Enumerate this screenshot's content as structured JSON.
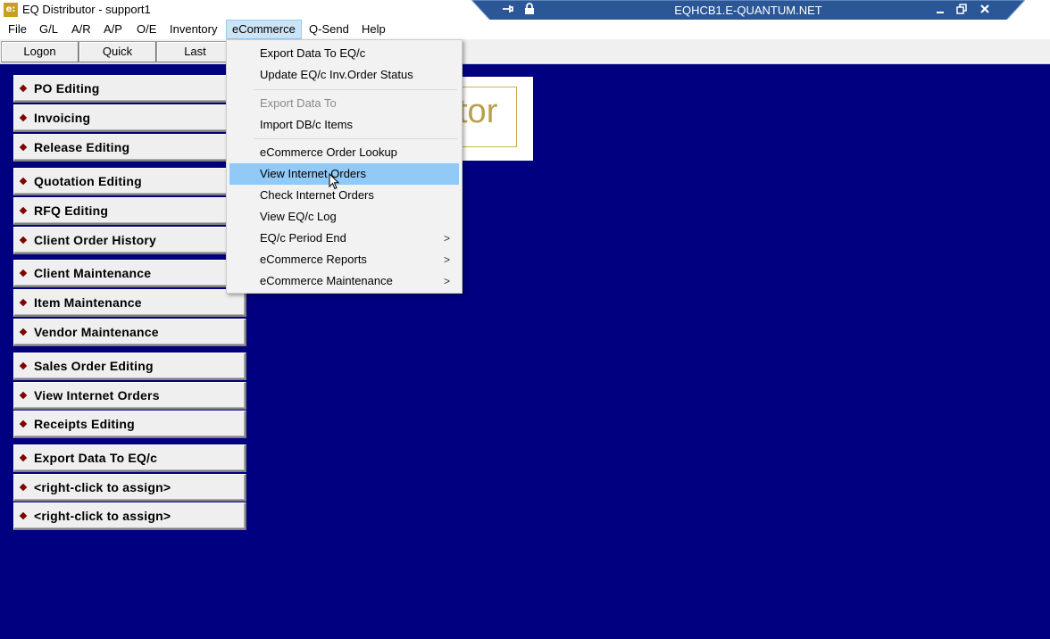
{
  "window": {
    "title": "EQ Distributor - support1",
    "icon_text": "e:"
  },
  "remote": {
    "host": "EQHCB1.E-QUANTUM.NET",
    "pin_icon": "pin-icon",
    "lock_icon": "lock-icon",
    "minimize_icon": "minimize-icon",
    "restore_icon": "restore-icon",
    "close_icon": "close-icon"
  },
  "menubar": {
    "items": [
      "File",
      "G/L",
      "A/R",
      "A/P",
      "O/E",
      "Inventory",
      "eCommerce",
      "Q-Send",
      "Help"
    ],
    "active": "eCommerce"
  },
  "toolbar": {
    "buttons": [
      "Logon",
      "Quick",
      "Last"
    ]
  },
  "side_buttons": [
    "PO Editing",
    "Invoicing",
    "Release Editing",
    "Quotation Editing",
    "RFQ Editing",
    "Client Order History",
    "Client Maintenance",
    "Item Maintenance",
    "Vendor Maintenance",
    "Sales Order Editing",
    "View Internet Orders",
    "Receipts Editing",
    "Export Data To EQ/c",
    "<right-click to assign>",
    "<right-click to assign>"
  ],
  "logo": {
    "text": "tor"
  },
  "ecommerce_menu": {
    "items": [
      {
        "label": "Export Data To EQ/c",
        "disabled": false,
        "submenu": false
      },
      {
        "label": "Update EQ/c Inv.Order Status",
        "disabled": false,
        "submenu": false
      },
      {
        "label": "Export Data To",
        "disabled": true,
        "submenu": false
      },
      {
        "label": "Import DB/c Items",
        "disabled": false,
        "submenu": false
      },
      {
        "label": "eCommerce Order Lookup",
        "disabled": false,
        "submenu": false
      },
      {
        "label": "View Internet Orders",
        "disabled": false,
        "submenu": false,
        "highlighted": true
      },
      {
        "label": "Check Internet Orders",
        "disabled": false,
        "submenu": false
      },
      {
        "label": "View EQ/c Log",
        "disabled": false,
        "submenu": false
      },
      {
        "label": "EQ/c Period End",
        "disabled": false,
        "submenu": true
      },
      {
        "label": "eCommerce Reports",
        "disabled": false,
        "submenu": true
      },
      {
        "label": "eCommerce Maintenance",
        "disabled": false,
        "submenu": true
      }
    ],
    "submenu_arrow": ">"
  },
  "colors": {
    "desktop": "#000080",
    "menu_highlight": "#91c9f7",
    "diamond": "#800000",
    "remote_bar": "#2b5797"
  }
}
